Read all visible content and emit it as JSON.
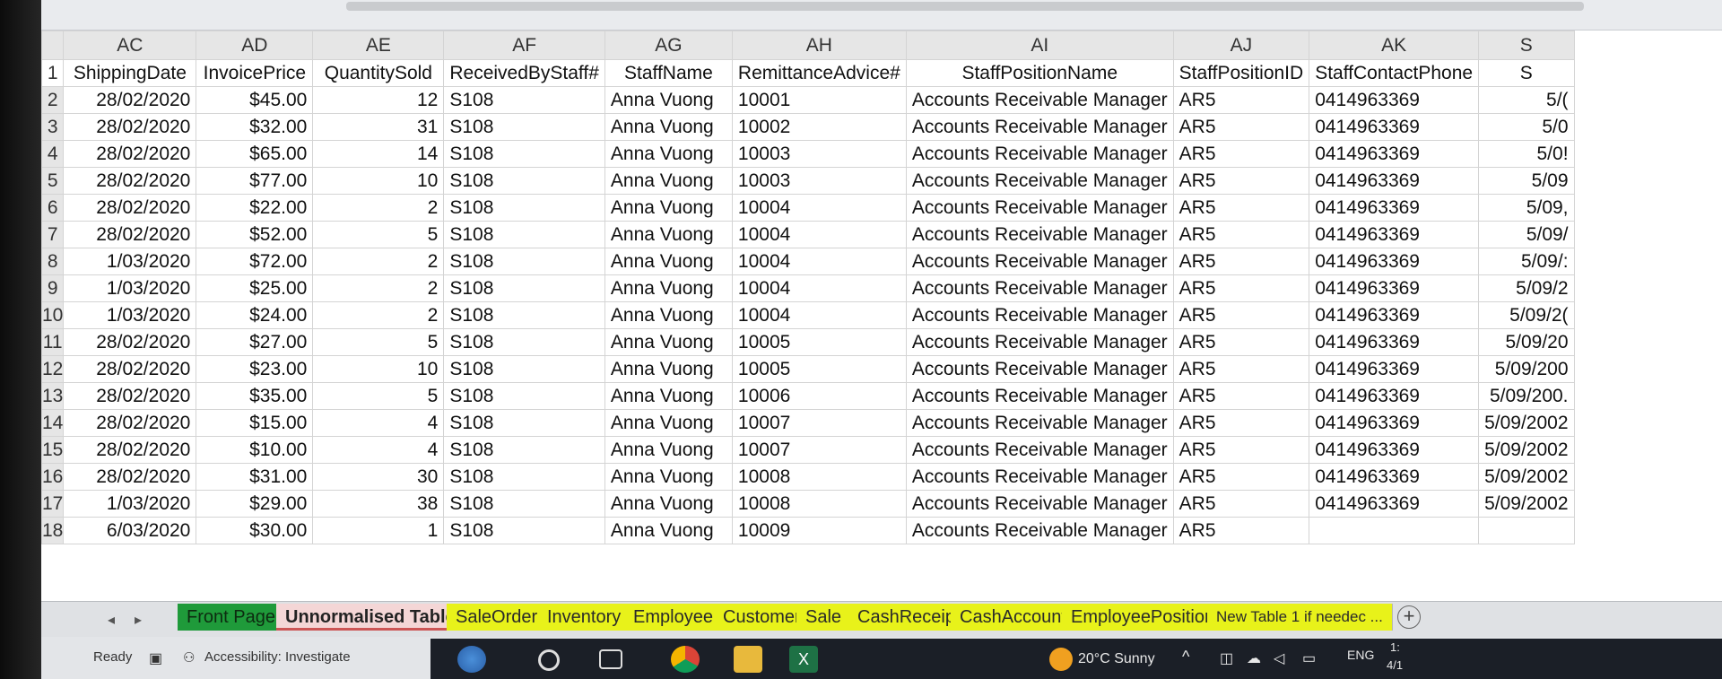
{
  "columns": [
    "AC",
    "AD",
    "AE",
    "AF",
    "AG",
    "AH",
    "AI",
    "AJ",
    "AK",
    "S"
  ],
  "headers": [
    "ShippingDate",
    "InvoicePrice",
    "QuantitySold",
    "ReceivedByStaff#",
    "StaffName",
    "RemittanceAdvice#",
    "StaffPositionName",
    "StaffPositionID",
    "StaffContactPhone",
    "S"
  ],
  "header_row_number": "1",
  "rows": [
    {
      "n": "2",
      "date": "28/02/2020",
      "price": "$45.00",
      "qty": "12",
      "staff": "S108",
      "name": "Anna Vuong",
      "ra": "10001",
      "pos": "Accounts Receivable Manager",
      "pid": "AR5",
      "phone": "0414963369",
      "extra": "5/("
    },
    {
      "n": "3",
      "date": "28/02/2020",
      "price": "$32.00",
      "qty": "31",
      "staff": "S108",
      "name": "Anna Vuong",
      "ra": "10002",
      "pos": "Accounts Receivable Manager",
      "pid": "AR5",
      "phone": "0414963369",
      "extra": "5/0"
    },
    {
      "n": "4",
      "date": "28/02/2020",
      "price": "$65.00",
      "qty": "14",
      "staff": "S108",
      "name": "Anna Vuong",
      "ra": "10003",
      "pos": "Accounts Receivable Manager",
      "pid": "AR5",
      "phone": "0414963369",
      "extra": "5/0!"
    },
    {
      "n": "5",
      "date": "28/02/2020",
      "price": "$77.00",
      "qty": "10",
      "staff": "S108",
      "name": "Anna Vuong",
      "ra": "10003",
      "pos": "Accounts Receivable Manager",
      "pid": "AR5",
      "phone": "0414963369",
      "extra": "5/09"
    },
    {
      "n": "6",
      "date": "28/02/2020",
      "price": "$22.00",
      "qty": "2",
      "staff": "S108",
      "name": "Anna Vuong",
      "ra": "10004",
      "pos": "Accounts Receivable Manager",
      "pid": "AR5",
      "phone": "0414963369",
      "extra": "5/09,"
    },
    {
      "n": "7",
      "date": "28/02/2020",
      "price": "$52.00",
      "qty": "5",
      "staff": "S108",
      "name": "Anna Vuong",
      "ra": "10004",
      "pos": "Accounts Receivable Manager",
      "pid": "AR5",
      "phone": "0414963369",
      "extra": "5/09/"
    },
    {
      "n": "8",
      "date": "1/03/2020",
      "price": "$72.00",
      "qty": "2",
      "staff": "S108",
      "name": "Anna Vuong",
      "ra": "10004",
      "pos": "Accounts Receivable Manager",
      "pid": "AR5",
      "phone": "0414963369",
      "extra": "5/09/:"
    },
    {
      "n": "9",
      "date": "1/03/2020",
      "price": "$25.00",
      "qty": "2",
      "staff": "S108",
      "name": "Anna Vuong",
      "ra": "10004",
      "pos": "Accounts Receivable Manager",
      "pid": "AR5",
      "phone": "0414963369",
      "extra": "5/09/2"
    },
    {
      "n": "10",
      "date": "1/03/2020",
      "price": "$24.00",
      "qty": "2",
      "staff": "S108",
      "name": "Anna Vuong",
      "ra": "10004",
      "pos": "Accounts Receivable Manager",
      "pid": "AR5",
      "phone": "0414963369",
      "extra": "5/09/2("
    },
    {
      "n": "11",
      "date": "28/02/2020",
      "price": "$27.00",
      "qty": "5",
      "staff": "S108",
      "name": "Anna Vuong",
      "ra": "10005",
      "pos": "Accounts Receivable Manager",
      "pid": "AR5",
      "phone": "0414963369",
      "extra": "5/09/20"
    },
    {
      "n": "12",
      "date": "28/02/2020",
      "price": "$23.00",
      "qty": "10",
      "staff": "S108",
      "name": "Anna Vuong",
      "ra": "10005",
      "pos": "Accounts Receivable Manager",
      "pid": "AR5",
      "phone": "0414963369",
      "extra": "5/09/200"
    },
    {
      "n": "13",
      "date": "28/02/2020",
      "price": "$35.00",
      "qty": "5",
      "staff": "S108",
      "name": "Anna Vuong",
      "ra": "10006",
      "pos": "Accounts Receivable Manager",
      "pid": "AR5",
      "phone": "0414963369",
      "extra": "5/09/200."
    },
    {
      "n": "14",
      "date": "28/02/2020",
      "price": "$15.00",
      "qty": "4",
      "staff": "S108",
      "name": "Anna Vuong",
      "ra": "10007",
      "pos": "Accounts Receivable Manager",
      "pid": "AR5",
      "phone": "0414963369",
      "extra": "5/09/2002"
    },
    {
      "n": "15",
      "date": "28/02/2020",
      "price": "$10.00",
      "qty": "4",
      "staff": "S108",
      "name": "Anna Vuong",
      "ra": "10007",
      "pos": "Accounts Receivable Manager",
      "pid": "AR5",
      "phone": "0414963369",
      "extra": "5/09/2002"
    },
    {
      "n": "16",
      "date": "28/02/2020",
      "price": "$31.00",
      "qty": "30",
      "staff": "S108",
      "name": "Anna Vuong",
      "ra": "10008",
      "pos": "Accounts Receivable Manager",
      "pid": "AR5",
      "phone": "0414963369",
      "extra": "5/09/2002"
    },
    {
      "n": "17",
      "date": "1/03/2020",
      "price": "$29.00",
      "qty": "38",
      "staff": "S108",
      "name": "Anna Vuong",
      "ra": "10008",
      "pos": "Accounts Receivable Manager",
      "pid": "AR5",
      "phone": "0414963369",
      "extra": "5/09/2002"
    },
    {
      "n": "18",
      "date": "6/03/2020",
      "price": "$30.00",
      "qty": "1",
      "staff": "S108",
      "name": "Anna Vuong",
      "ra": "10009",
      "pos": "Accounts Receivable Manager",
      "pid": "AR5",
      "phone": "",
      "extra": ""
    }
  ],
  "sheet_tabs": {
    "nav_prev": "◂",
    "nav_next": "▸",
    "front_page": "Front Page",
    "unnormalised": "Unnormalised Table",
    "sale_order": "SaleOrder",
    "inventory": "Inventory",
    "employee": "Employee",
    "customer": "Customer",
    "sale": "Sale",
    "cash_receipt": "CashReceipt",
    "cash_account": "CashAccount",
    "employee_position": "EmployeePosition",
    "new_table": "New Table 1 if needec ...",
    "add": "+"
  },
  "status": {
    "ready": "Ready",
    "accessibility": "Accessibility: Investigate"
  },
  "taskbar": {
    "weather": "20°C Sunny",
    "language": "ENG",
    "clock_top": "1:",
    "clock_bottom": "4/1"
  },
  "colors": {
    "front_tab": "#1f9a3a",
    "yellow_tab": "#e8f21a",
    "active_tab": "#f4d6d6",
    "excel_green": "#1e7145"
  }
}
